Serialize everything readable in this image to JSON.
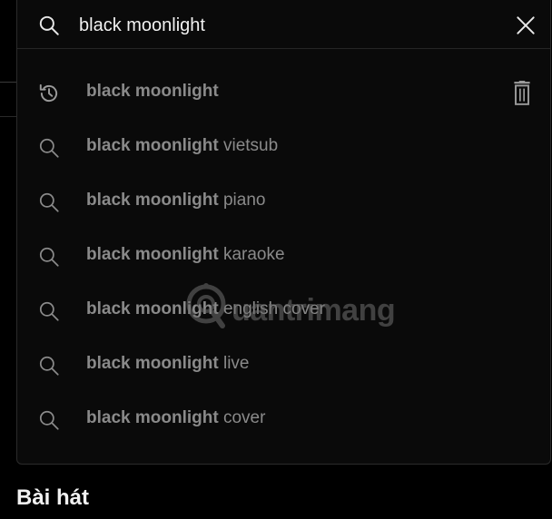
{
  "search": {
    "query": "black moonlight",
    "placeholder": "Search",
    "close_icon": "close-icon",
    "search_icon": "search-icon"
  },
  "suggestions": [
    {
      "bold": "black moonlight",
      "rest": "",
      "icon": "history-icon",
      "deletable": true
    },
    {
      "bold": "black moonlight",
      "rest": " vietsub",
      "icon": "search-icon"
    },
    {
      "bold": "black moonlight",
      "rest": " piano",
      "icon": "search-icon"
    },
    {
      "bold": "black moonlight",
      "rest": " karaoke",
      "icon": "search-icon"
    },
    {
      "bold": "black moonlight",
      "rest": " english cover",
      "icon": "search-icon"
    },
    {
      "bold": "black moonlight",
      "rest": " live",
      "icon": "search-icon"
    },
    {
      "bold": "black moonlight",
      "rest": " cover",
      "icon": "search-icon"
    }
  ],
  "watermark": {
    "text": "uantrimang"
  },
  "section": {
    "heading": "Bài hát"
  },
  "colors": {
    "background": "#000000",
    "panel": "#0a0a0a",
    "text_primary": "#f1f1f1",
    "text_muted": "#8a8a8a",
    "icon": "#9a9a9a"
  }
}
